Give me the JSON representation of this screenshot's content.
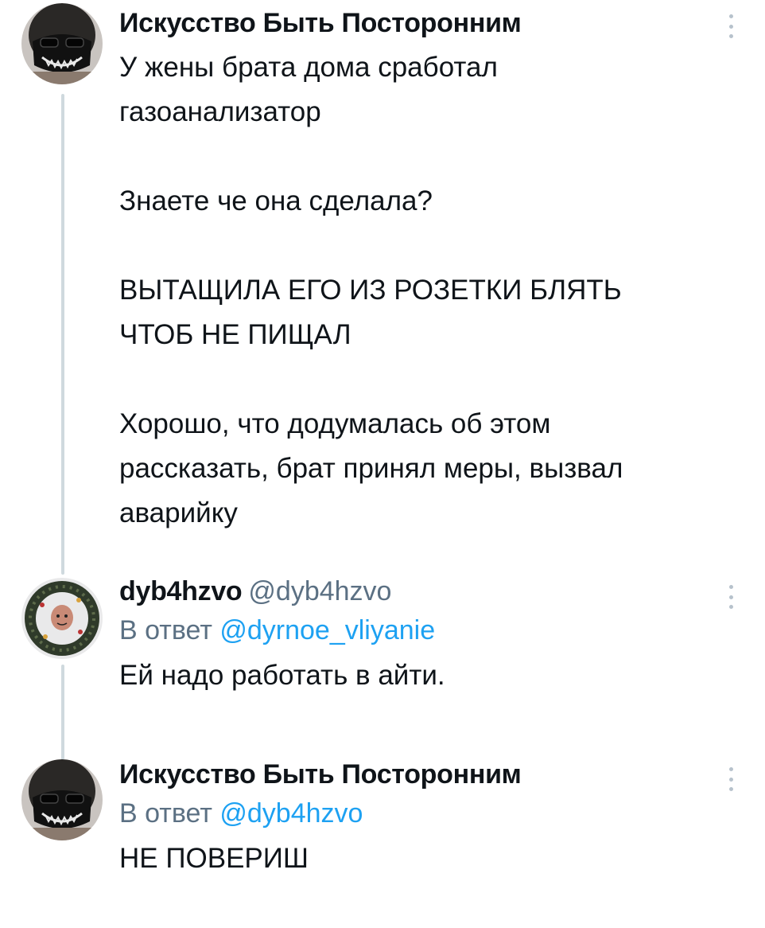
{
  "tweets": [
    {
      "author": "Искусство Быть Посторонним",
      "text": "У жены брата дома сработал\nгазоанализатор\n\nЗнаете че она сделала?\n\nВЫТАЩИЛА ЕГО ИЗ РОЗЕТКИ БЛЯТЬ\nЧТОБ НЕ ПИЩАЛ\n\nХорошо, что додумалась об этом\nрассказать, брат принял меры, вызвал\nаварийку"
    },
    {
      "author": "dyb4hzvo",
      "handle": "@dyb4hzvo",
      "reply_prefix": "В ответ",
      "reply_to": "@dyrnoe_vliyanie",
      "text": "Ей надо работать в айти."
    },
    {
      "author": "Искусство Быть Посторонним",
      "reply_prefix": "В ответ",
      "reply_to": "@dyb4hzvo",
      "text": "НЕ ПОВЕРИШ"
    }
  ],
  "colors": {
    "text": "#0f1419",
    "secondary": "#5b7083",
    "link": "#1da1f2",
    "thread_line": "#cfd9de"
  },
  "icons": [
    "avatar-mask",
    "avatar-wreath",
    "more-options-icon"
  ]
}
